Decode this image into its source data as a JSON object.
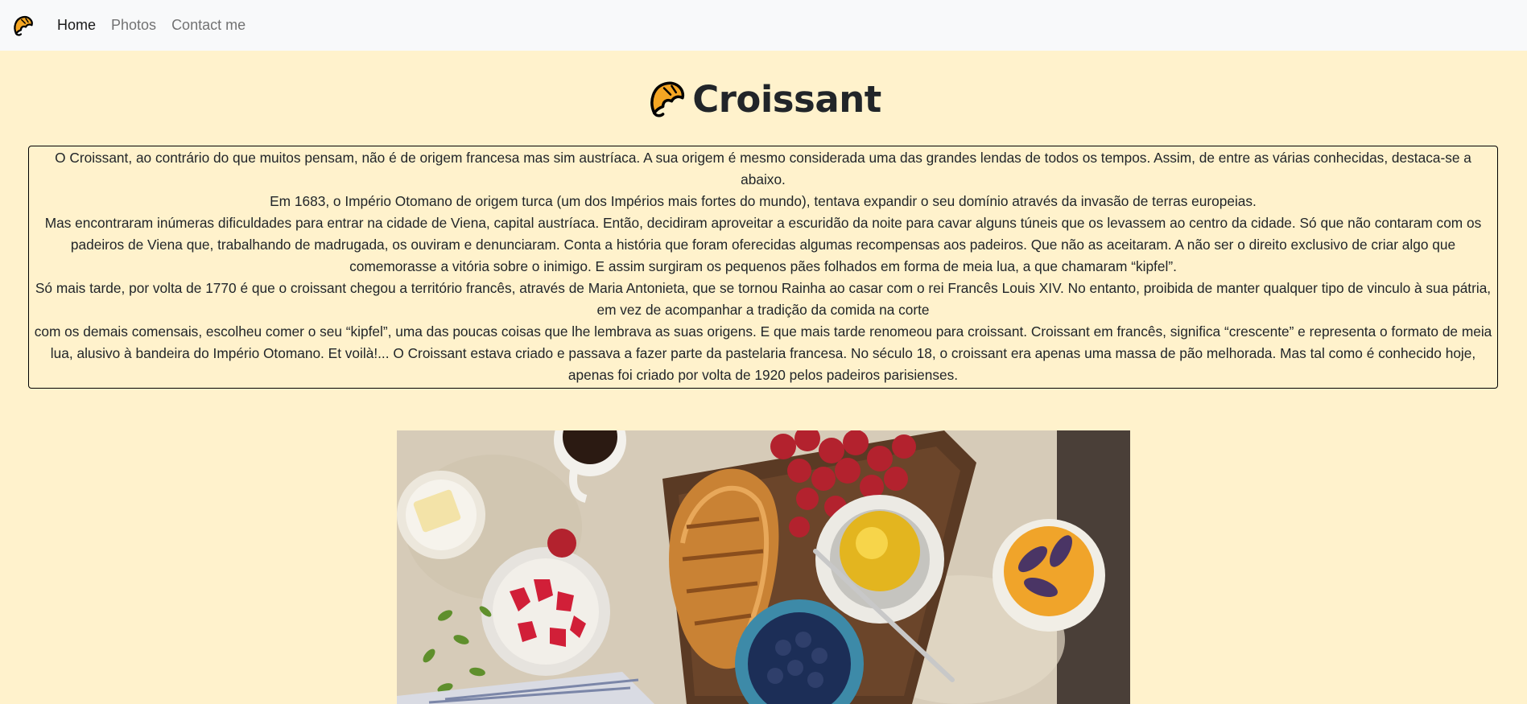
{
  "nav": {
    "brand_icon": "croissant-icon",
    "items": [
      {
        "label": "Home",
        "active": true
      },
      {
        "label": "Photos",
        "active": false
      },
      {
        "label": "Contact me",
        "active": false
      }
    ]
  },
  "header": {
    "title": "Croissant",
    "icon": "croissant-icon"
  },
  "story": {
    "paragraphs": [
      "O Croissant, ao contrário do que muitos pensam, não é de origem francesa mas sim austríaca. A sua origem é mesmo considerada uma das grandes lendas de todos os tempos. Assim, de entre as várias conhecidas, destaca-se a abaixo.",
      "Em 1683, o Império Otomano de origem turca (um dos Impérios mais fortes do mundo), tentava expandir o seu domínio através da invasão de terras europeias.",
      "Mas encontraram inúmeras dificuldades para entrar na cidade de Viena, capital austríaca. Então, decidiram aproveitar a escuridão da noite para cavar alguns túneis que os levassem ao centro da cidade. Só que não contaram com os padeiros de Viena que, trabalhando de madrugada, os ouviram e denunciaram. Conta a história que foram oferecidas algumas recompensas aos padeiros. Que não as aceitaram. A não ser o direito exclusivo de criar algo que comemorasse a vitória sobre o inimigo. E assim surgiram os pequenos pães folhados em forma de meia lua, a que chamaram “kipfel”.",
      "Só mais tarde, por volta de 1770 é que o croissant chegou a território francês, através de Maria Antonieta, que se tornou Rainha ao casar com o rei Francês Louis XIV. No entanto, proibida de manter qualquer tipo de vinculo à sua pátria, em vez de acompanhar a tradição da comida na corte",
      "com os demais comensais, escolheu comer o seu “kipfel”, uma das poucas coisas que lhe lembrava as suas origens. E que mais tarde renomeou para croissant. Croissant em francês, significa “crescente” e representa o formato de meia lua, alusivo à bandeira do Império Otomano. Et voilà!... O Croissant estava criado e passava a fazer parte da pastelaria francesa. No século 18, o croissant era apenas uma massa de pão melhorada. Mas tal como é conhecido hoje, apenas foi criado por volta de 1920 pelos padeiros parisienses."
    ]
  },
  "colors": {
    "page_background": "#fff2cc",
    "navbar_background": "#f8f9fa",
    "croissant_fill": "#f5a623",
    "croissant_outline": "#000000"
  }
}
